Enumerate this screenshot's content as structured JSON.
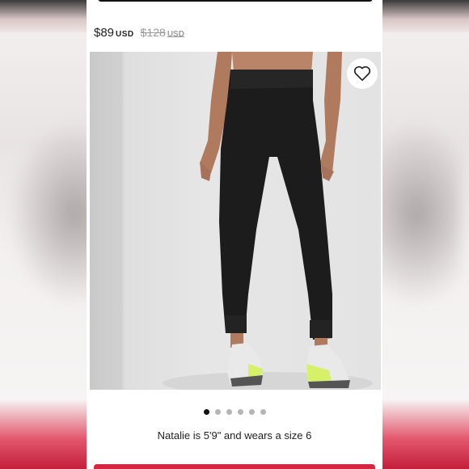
{
  "product": {
    "price": "$89",
    "price_currency": "USD",
    "original_price": "$128",
    "original_currency": "USD"
  },
  "gallery": {
    "image_count": 6,
    "active_index": 0,
    "wishlist_icon": "heart-icon"
  },
  "caption": "Natalie is 5'9\" and wears a size 6",
  "colors": {
    "accent": "#d6263f",
    "text": "#222222",
    "strike": "#9a9a9a"
  }
}
